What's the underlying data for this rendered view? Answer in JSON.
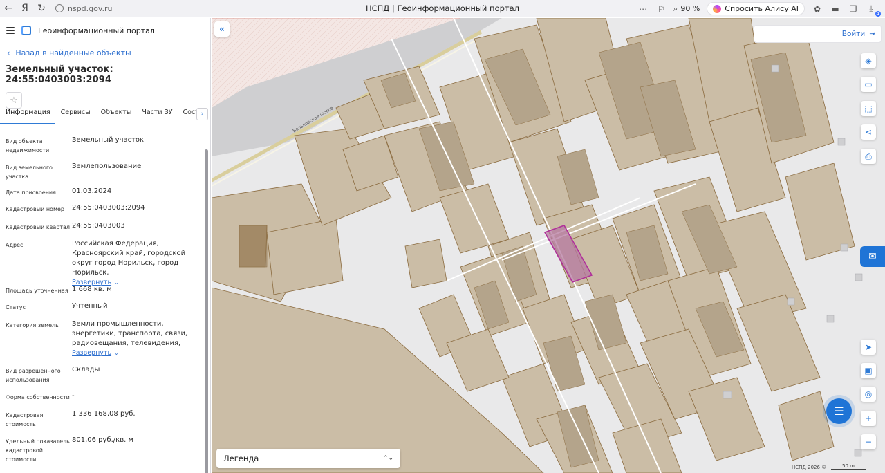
{
  "browser": {
    "url": "nspd.gov.ru",
    "title": "НСПД | Геоинформационный портал",
    "zoom": "90 %",
    "alice_label": "Спросить Алису AI",
    "downloads_badge": "4"
  },
  "sidebar": {
    "portal_name": "Геоинформационный портал",
    "back_label": "Назад в найденные объекты",
    "object_title": "Земельный участок: 24:55:0403003:2094",
    "tabs": [
      "Информация",
      "Сервисы",
      "Объекты",
      "Части ЗУ",
      "Состав"
    ],
    "properties": [
      {
        "label": "Вид объекта недвижимости",
        "value": "Земельный участок"
      },
      {
        "label": "Вид земельного участка",
        "value": "Землепользование"
      },
      {
        "label": "Дата присвоения",
        "value": "01.03.2024"
      },
      {
        "label": "Кадастровый номер",
        "value": "24:55:0403003:2094"
      },
      {
        "label": "Кадастровый квартал",
        "value": "24:55:0403003"
      },
      {
        "label": "Адрес",
        "value": "Российская Федерация, Красноярский край, городской округ город Норильск, город Норильск,",
        "expand": "Развернуть"
      },
      {
        "label": "Площадь уточненная",
        "value": "1 668 кв. м"
      },
      {
        "label": "Статус",
        "value": "Учтенный"
      },
      {
        "label": "Категория земель",
        "value": "Земли промышленности, энергетики, транспорта, связи, радиовещания, телевидения,",
        "expand": "Развернуть"
      },
      {
        "label": "Вид разрешенного использования",
        "value": "Склады"
      },
      {
        "label": "Форма собственности",
        "value": "-"
      },
      {
        "label": "Кадастровая стоимость",
        "value": "1 336 168,08 руб."
      },
      {
        "label": "Удельный показатель кадастровой стоимости",
        "value": "801,06 руб./кв. м"
      }
    ]
  },
  "map": {
    "login_label": "Войти",
    "legend_label": "Легенда",
    "attribution": "НСПД 2026 ©",
    "scale_label": "50 m",
    "road_label": "Вальковское шоссе",
    "tools": [
      "layers-icon",
      "ruler-icon",
      "select-area-icon",
      "share-icon",
      "print-icon"
    ],
    "right_tools": [
      "locate-icon",
      "minimap-icon",
      "geolocation-icon",
      "zoom-in-icon",
      "zoom-out-icon"
    ],
    "colors": {
      "parcel_fill": "#cbbda6",
      "parcel_stroke": "#8a6a3e",
      "building_fill": "#b4a48b",
      "selected_stroke": "#b0309a",
      "selected_fill": "#b57aa0",
      "accent": "#1f74d6"
    }
  }
}
